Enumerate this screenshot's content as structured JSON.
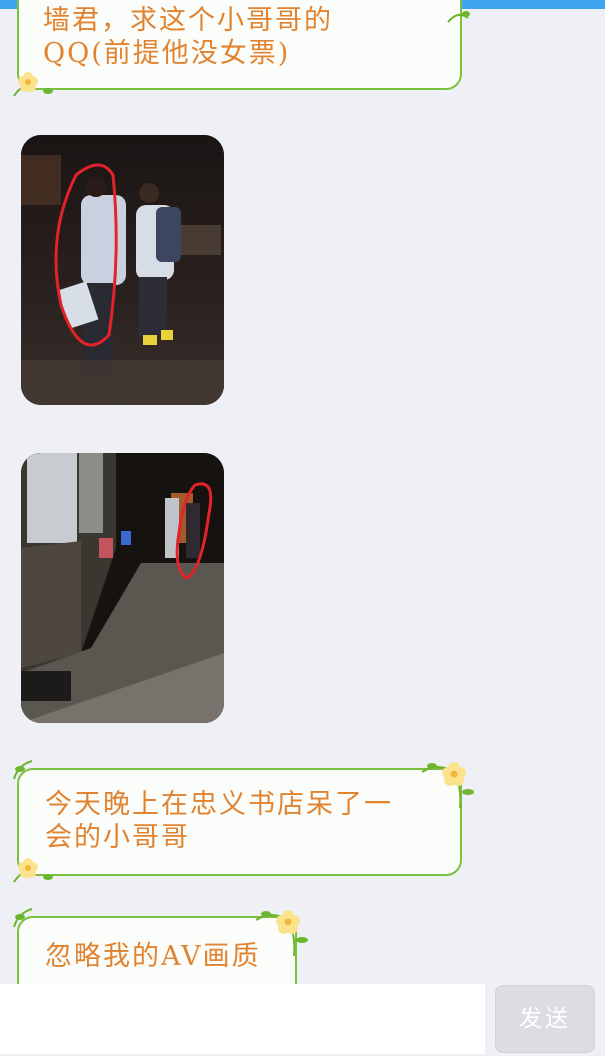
{
  "messages": [
    {
      "lines": [
        "墙君，求这个小哥哥的",
        "QQ(前提他没女票)"
      ]
    },
    {
      "lines": [
        "今天晚上在忠义书店呆了一",
        "会的小哥哥"
      ]
    },
    {
      "lines": [
        "忽略我的AV画质"
      ]
    }
  ],
  "photos": [
    {
      "icon": "photo-two-students-walking"
    },
    {
      "icon": "photo-street-at-night"
    }
  ],
  "input": {
    "value": ""
  },
  "send_button": {
    "label": "发送"
  },
  "colors": {
    "bubble_border": "#7cc13d",
    "bubble_text": "#e2832f",
    "background": "#eef0f6",
    "top_bar": "#3ea6ee",
    "annotation_circle": "#e3222a"
  }
}
